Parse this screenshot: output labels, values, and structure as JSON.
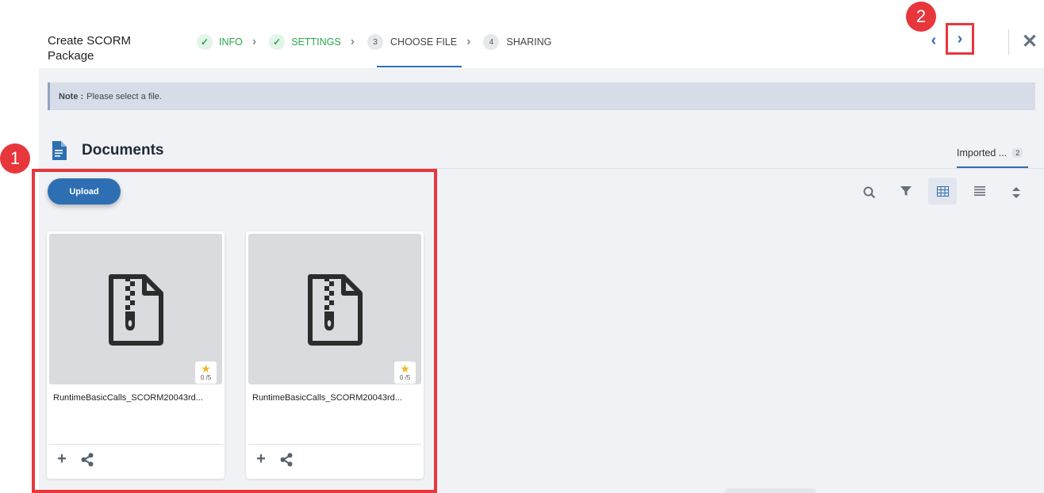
{
  "header": {
    "title": "Create SCORM Package",
    "steps": [
      {
        "label": "INFO",
        "status": "done",
        "marker": "✓"
      },
      {
        "label": "SETTINGS",
        "status": "done",
        "marker": "✓"
      },
      {
        "label": "CHOOSE FILE",
        "status": "active",
        "marker": "3"
      },
      {
        "label": "SHARING",
        "status": "pending",
        "marker": "4"
      }
    ],
    "prev_icon": "‹",
    "next_icon": "›",
    "close_icon": "✕"
  },
  "annotations": {
    "badge1": "1",
    "badge2": "2"
  },
  "note": {
    "label": "Note :",
    "text": "Please select a file."
  },
  "documents": {
    "title": "Documents",
    "tab_label": "Imported ...",
    "tab_count": "2",
    "upload_label": "Upload",
    "files": [
      {
        "name": "RuntimeBasicCalls_SCORM20043rd...",
        "rating": "0 /5"
      },
      {
        "name": "RuntimeBasicCalls_SCORM20043rd...",
        "rating": "0 /5"
      }
    ]
  },
  "colors": {
    "accent": "#2e6fb3",
    "success": "#29a84d",
    "annotation": "#e8363d",
    "star": "#f1b72b"
  }
}
